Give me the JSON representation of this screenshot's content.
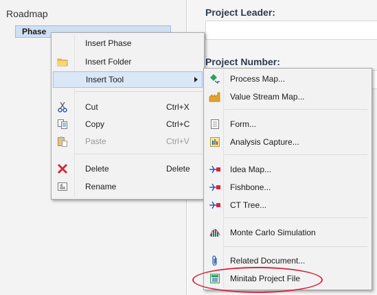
{
  "tree": {
    "title": "Roadmap",
    "selected_item": "Phase"
  },
  "form": {
    "project_leader_label": "Project Leader:",
    "project_number_label": "Project Number:"
  },
  "context_menu": {
    "items": [
      {
        "label": "Insert Phase",
        "shortcut": "",
        "icon": "none"
      },
      {
        "label": "Insert Folder",
        "shortcut": "",
        "icon": "folder-icon"
      },
      {
        "label": "Insert Tool",
        "shortcut": "",
        "icon": "none",
        "has_submenu": true,
        "highlighted": true
      },
      {
        "label": "Cut",
        "shortcut": "Ctrl+X",
        "icon": "scissors-icon"
      },
      {
        "label": "Copy",
        "shortcut": "Ctrl+C",
        "icon": "copy-icon"
      },
      {
        "label": "Paste",
        "shortcut": "Ctrl+V",
        "icon": "paste-icon",
        "disabled": true
      },
      {
        "label": "Delete",
        "shortcut": "Delete",
        "icon": "delete-x-icon"
      },
      {
        "label": "Rename",
        "shortcut": "",
        "icon": "rename-icon"
      }
    ]
  },
  "submenu": {
    "items": [
      {
        "label": "Process Map...",
        "icon": "process-map-icon"
      },
      {
        "label": "Value Stream Map...",
        "icon": "factory-icon"
      },
      {
        "label": "Form...",
        "icon": "form-icon"
      },
      {
        "label": "Analysis Capture...",
        "icon": "analysis-capture-icon"
      },
      {
        "label": "Idea Map...",
        "icon": "tree-diagram-icon"
      },
      {
        "label": "Fishbone...",
        "icon": "tree-diagram-icon"
      },
      {
        "label": "CT Tree...",
        "icon": "tree-diagram-icon"
      },
      {
        "label": "Monte Carlo Simulation",
        "icon": "monte-carlo-icon"
      },
      {
        "label": "Related Document...",
        "icon": "paperclip-icon"
      },
      {
        "label": "Minitab Project File",
        "icon": "minitab-file-icon"
      }
    ]
  },
  "colors": {
    "highlight_oval": "#d7263d",
    "menu_hover": "#d9e7f7",
    "selected_item": "#cfe0f3"
  }
}
